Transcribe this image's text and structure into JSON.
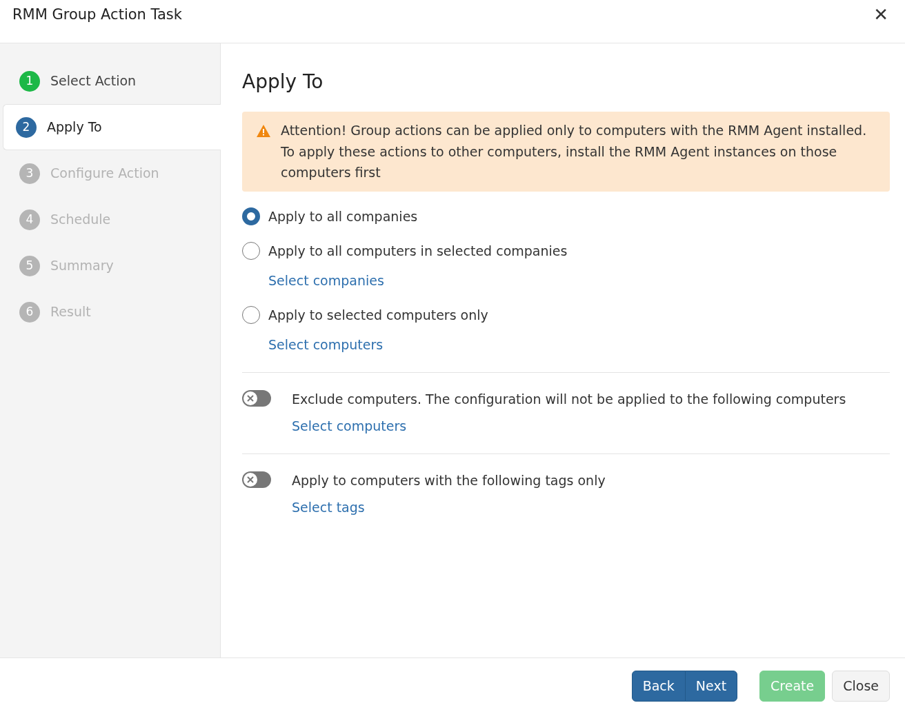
{
  "window": {
    "title": "RMM Group Action Task",
    "close": "✕"
  },
  "steps": [
    {
      "number": "1",
      "label": "Select Action",
      "completed": true,
      "disabled": false,
      "selected": false
    },
    {
      "number": "2",
      "label": "Apply To",
      "completed": false,
      "disabled": false,
      "selected": true
    },
    {
      "number": "3",
      "label": "Configure Action",
      "completed": false,
      "disabled": true,
      "selected": false
    },
    {
      "number": "4",
      "label": "Schedule",
      "completed": false,
      "disabled": true,
      "selected": false
    },
    {
      "number": "5",
      "label": "Summary",
      "completed": false,
      "disabled": true,
      "selected": false
    },
    {
      "number": "6",
      "label": "Result",
      "completed": false,
      "disabled": true,
      "selected": false
    }
  ],
  "heading": "Apply To",
  "alert": "Attention! Group actions can be applied only to computers with the RMM Agent installed. To apply these actions to other computers, install the RMM Agent instances on those computers first",
  "options": [
    {
      "label": "Apply to all companies",
      "selected": true
    },
    {
      "label": "Apply to all computers in selected companies",
      "selected": false,
      "link": "Select companies"
    },
    {
      "label": "Apply to selected computers only",
      "selected": false,
      "link": "Select computers"
    }
  ],
  "toggles": [
    {
      "label": "Exclude computers. The configuration will not be applied to the following computers",
      "on": false,
      "link": "Select computers"
    },
    {
      "label": "Apply to computers with the following tags only",
      "on": false,
      "link": "Select tags"
    }
  ],
  "footer": {
    "nav": [
      {
        "label": "Back"
      },
      {
        "label": "Next"
      }
    ],
    "create": {
      "label": "Create",
      "disabled": true
    },
    "close": {
      "label": "Close"
    }
  }
}
